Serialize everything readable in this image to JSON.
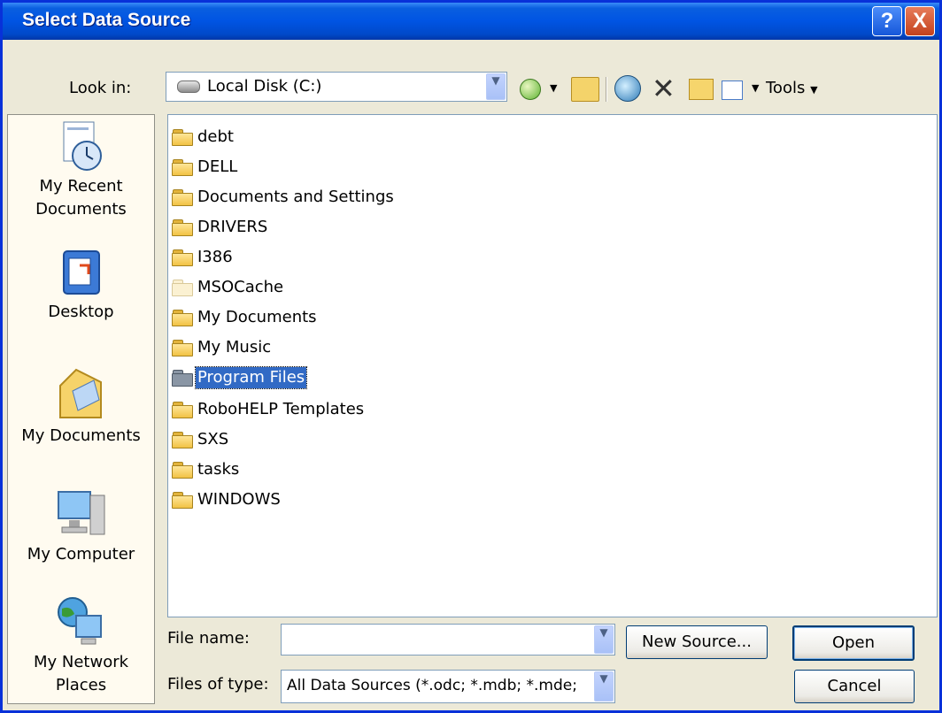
{
  "window": {
    "title": "Select Data Source",
    "help_label": "?",
    "close_label": "X"
  },
  "lookin": {
    "label": "Look in:",
    "value": "Local Disk (C:)"
  },
  "toolbar": {
    "tools_label": "Tools",
    "icons": [
      "back-icon",
      "up-folder-icon",
      "search-web-icon",
      "delete-icon",
      "new-folder-icon",
      "views-icon"
    ]
  },
  "places": [
    {
      "label": "My Recent Documents",
      "icon": "recent-documents-icon"
    },
    {
      "label": "Desktop",
      "icon": "desktop-icon"
    },
    {
      "label": "My Documents",
      "icon": "my-documents-icon"
    },
    {
      "label": "My Computer",
      "icon": "my-computer-icon"
    },
    {
      "label": "My Network Places",
      "icon": "network-places-icon"
    }
  ],
  "files": [
    {
      "name": "debt"
    },
    {
      "name": "DELL"
    },
    {
      "name": "Documents and Settings"
    },
    {
      "name": "DRIVERS"
    },
    {
      "name": "I386"
    },
    {
      "name": "MSOCache",
      "state": "hidden"
    },
    {
      "name": "My Documents"
    },
    {
      "name": "My Music"
    },
    {
      "name": "Program Files",
      "state": "selected"
    },
    {
      "name": "RoboHELP Templates"
    },
    {
      "name": "SXS"
    },
    {
      "name": "tasks"
    },
    {
      "name": "WINDOWS"
    }
  ],
  "filename": {
    "label": "File name:",
    "value": ""
  },
  "filetype": {
    "label": "Files of type:",
    "value": "All Data Sources (*.odc; *.mdb; *.mde;"
  },
  "buttons": {
    "new_source": "New Source...",
    "open": "Open",
    "cancel": "Cancel"
  },
  "colors": {
    "titlebar": "#0054e3",
    "selection": "#316ac5",
    "dialog_bg": "#ece9d8"
  }
}
